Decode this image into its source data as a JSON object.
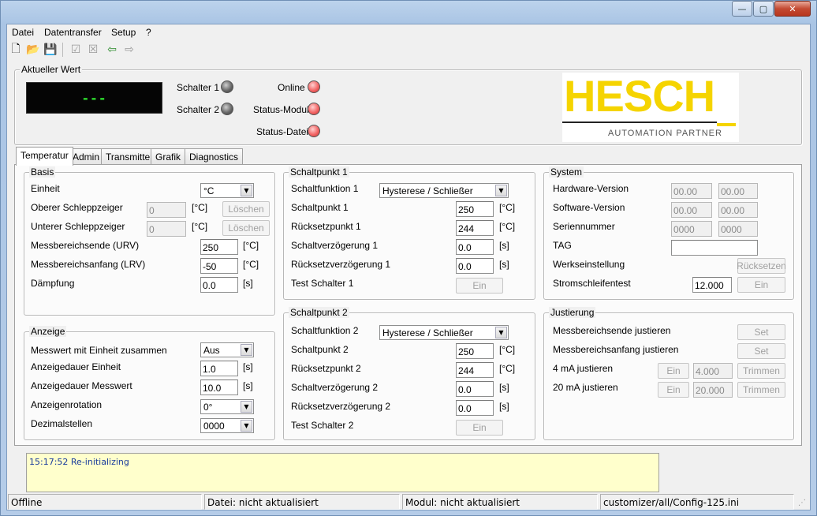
{
  "menu": [
    "Datei",
    "Datentransfer",
    "Setup",
    "?"
  ],
  "window_controls": {
    "minimize": "—",
    "maximize": "▢",
    "close": "✕"
  },
  "toolbar": [
    "new-file-icon",
    "open-folder-icon",
    "save-icon",
    "check-icon",
    "cancel-icon",
    "connect-icon",
    "disconnect-icon"
  ],
  "current_value": {
    "legend": "Aktueller Wert",
    "display": "---",
    "switch1": "Schalter 1",
    "switch2": "Schalter 2",
    "online": "Online",
    "status_module": "Status-Modul",
    "status_file": "Status-Datei"
  },
  "logo": {
    "name": "HESCH",
    "tagline": "AUTOMATION PARTNER",
    "color": "#f5d400"
  },
  "tabs": [
    "Temperatur",
    "Admin",
    "Transmitter",
    "Grafik",
    "Diagnostics"
  ],
  "basis": {
    "legend": "Basis",
    "unit_label": "Einheit",
    "unit_value": "°C",
    "upper_drag_label": "Oberer Schleppzeiger",
    "upper_drag_value": "0",
    "upper_drag_unit": "[°C]",
    "lower_drag_label": "Unterer Schleppzeiger",
    "lower_drag_value": "0",
    "lower_drag_unit": "[°C]",
    "clear_label": "Löschen",
    "urv_label": "Messbereichsende (URV)",
    "urv_value": "250",
    "urv_unit": "[°C]",
    "lrv_label": "Messbereichsanfang (LRV)",
    "lrv_value": "-50",
    "lrv_unit": "[°C]",
    "damping_label": "Dämpfung",
    "damping_value": "0.0",
    "damping_unit": "[s]"
  },
  "display": {
    "legend": "Anzeige",
    "combined_label": "Messwert mit Einheit zusammen",
    "combined_value": "Aus",
    "unit_duration_label": "Anzeigedauer Einheit",
    "unit_duration_value": "1.0",
    "unit_duration_unit": "[s]",
    "value_duration_label": "Anzeigedauer Messwert",
    "value_duration_value": "10.0",
    "value_duration_unit": "[s]",
    "rotation_label": "Anzeigenrotation",
    "rotation_value": "0°",
    "decimals_label": "Dezimalstellen",
    "decimals_value": "0000"
  },
  "sp1": {
    "legend": "Schaltpunkt 1",
    "func_label": "Schaltfunktion 1",
    "func_value": "Hysterese / Schließer",
    "point_label": "Schaltpunkt 1",
    "point_value": "250",
    "point_unit": "[°C]",
    "reset_label": "Rücksetzpunkt 1",
    "reset_value": "244",
    "reset_unit": "[°C]",
    "delay_label": "Schaltverzögerung 1",
    "delay_value": "0.0",
    "delay_unit": "[s]",
    "reset_delay_label": "Rücksetzverzögerung 1",
    "reset_delay_value": "0.0",
    "reset_delay_unit": "[s]",
    "test_label": "Test Schalter 1",
    "test_button": "Ein"
  },
  "sp2": {
    "legend": "Schaltpunkt 2",
    "func_label": "Schaltfunktion 2",
    "func_value": "Hysterese / Schließer",
    "point_label": "Schaltpunkt 2",
    "point_value": "250",
    "point_unit": "[°C]",
    "reset_label": "Rücksetzpunkt 2",
    "reset_value": "244",
    "reset_unit": "[°C]",
    "delay_label": "Schaltverzögerung 2",
    "delay_value": "0.0",
    "delay_unit": "[s]",
    "reset_delay_label": "Rücksetzverzögerung 2",
    "reset_delay_value": "0.0",
    "reset_delay_unit": "[s]",
    "test_label": "Test Schalter 2",
    "test_button": "Ein"
  },
  "system": {
    "legend": "System",
    "hw_label": "Hardware-Version",
    "hw_value1": "00.00",
    "hw_value2": "00.00",
    "sw_label": "Software-Version",
    "sw_value1": "00.00",
    "sw_value2": "00.00",
    "serial_label": "Seriennummer",
    "serial_value1": "0000",
    "serial_value2": "0000",
    "tag_label": "TAG",
    "tag_value": "",
    "factory_label": "Werkseinstellung",
    "factory_button": "Rücksetzen",
    "loop_label": "Stromschleifentest",
    "loop_value": "12.000",
    "loop_button": "Ein"
  },
  "adjust": {
    "legend": "Justierung",
    "end_label": "Messbereichsende justieren",
    "end_button": "Set",
    "start_label": "Messbereichsanfang justieren",
    "start_button": "Set",
    "ma4_label": "4 mA justieren",
    "ma4_on": "Ein",
    "ma4_value": "4.000",
    "ma4_trim": "Trimmen",
    "ma20_label": "20 mA justieren",
    "ma20_on": "Ein",
    "ma20_value": "20.000",
    "ma20_trim": "Trimmen"
  },
  "log": {
    "line1": "15:17:52 Re-initializing"
  },
  "status": {
    "connection": "Offline",
    "file": "Datei: nicht aktualisiert",
    "module": "Modul: nicht aktualisiert",
    "config": "customizer/all/Config-125.ini"
  }
}
